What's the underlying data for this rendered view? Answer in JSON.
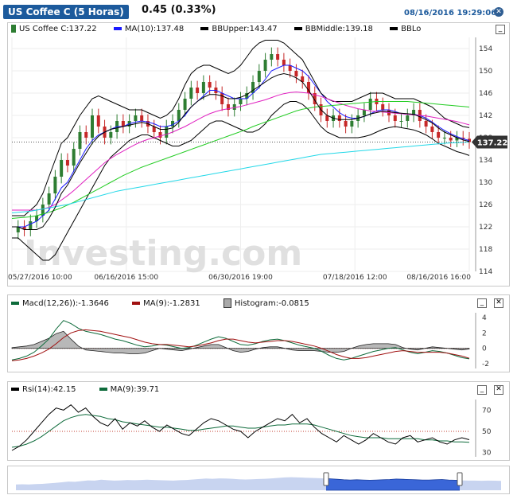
{
  "header": {
    "title": "US Coffee C (5 Horas)",
    "change": "0.45 (0.33%)",
    "datetime": "08/16/2016 19:29:06"
  },
  "main_panel": {
    "legend": [
      {
        "label": "US Coffee C:137.22",
        "color": "#2e7d32"
      },
      {
        "label": "MA(10):137.48",
        "color": "#1a1aff"
      },
      {
        "label": "BBUpper:143.47",
        "color": "#000000"
      },
      {
        "label": "BBMiddle:139.18",
        "color": "#000000"
      },
      {
        "label": "BBLo",
        "color": "#000000"
      }
    ],
    "minimize_label": "_",
    "price_tag": "137.22",
    "watermark": "Investing.com"
  },
  "macd_panel": {
    "legend": [
      {
        "label": "Macd(12,26)):-1.3646",
        "color": "#0e6b3b"
      },
      {
        "label": "MA(9):-1.2831",
        "color": "#a01010"
      },
      {
        "label": "Histogram:-0.0815",
        "color": "#888888"
      }
    ],
    "minimize_label": "_",
    "close_label": "✕"
  },
  "rsi_panel": {
    "legend": [
      {
        "label": "Rsi(14):42.15",
        "color": "#000000"
      },
      {
        "label": "MA(9):39.71",
        "color": "#0e6b3b"
      }
    ],
    "minimize_label": "_",
    "close_label": "✕"
  },
  "colors": {
    "brand": "#1c5a9c",
    "up_candle": "#2e7d32",
    "down_candle": "#c62828",
    "ma10": "#1a1aff",
    "ma_pink": "#e020c0",
    "ma_green": "#22cc22",
    "ma_cyan": "#22d8e8",
    "bands": "#000000",
    "navigator_fill": "#3a66d8"
  },
  "chart_data": [
    {
      "type": "line",
      "x_ticks": [
        "05/27/2016 10:00",
        "06/16/2016 15:00",
        "06/30/2016 19:00",
        "07/18/2016 12:00",
        "08/16/2016 16:00"
      ],
      "y_ticks": [
        114,
        118,
        122,
        126,
        130,
        134,
        138,
        142,
        146,
        150,
        154
      ],
      "ylim": [
        114,
        156
      ],
      "last_price": 137.22,
      "series": [
        {
          "name": "US Coffee C",
          "values": [
            121,
            122,
            121.5,
            123,
            124,
            126,
            128,
            131,
            134,
            133,
            136,
            139,
            138,
            142,
            140,
            138,
            139,
            141,
            140,
            141,
            142,
            141,
            140,
            139,
            138,
            140,
            141,
            143,
            145,
            147,
            146,
            148,
            147,
            146,
            144,
            143,
            144,
            145,
            146,
            148,
            150,
            152,
            153,
            152,
            151,
            150,
            149,
            148,
            146,
            144,
            142,
            141,
            142,
            141,
            140,
            141,
            142,
            143,
            145,
            144,
            143,
            142,
            141,
            141,
            142,
            143,
            141,
            140,
            139,
            138,
            138,
            137.5,
            138,
            137.8,
            137.22
          ]
        },
        {
          "name": "MA(10)",
          "values": [
            122,
            122,
            122,
            122.5,
            123,
            124,
            125,
            127,
            129,
            130,
            132,
            134,
            136,
            137.5,
            138.5,
            139,
            139.5,
            140,
            140,
            140.5,
            140.8,
            141,
            140.8,
            140.5,
            140,
            140,
            140.3,
            141,
            142,
            143.5,
            144.5,
            145.5,
            146.5,
            146.5,
            146,
            145.5,
            145,
            145,
            145,
            146,
            147,
            148.5,
            150,
            150.5,
            151,
            151,
            150.5,
            150,
            149,
            147.5,
            146,
            144.5,
            143.5,
            142.5,
            141.8,
            141.5,
            141.5,
            141.8,
            142.3,
            142.8,
            143,
            143,
            142.7,
            142.3,
            142.2,
            142.2,
            142,
            141.5,
            140.8,
            140,
            139.3,
            138.7,
            138.2,
            137.8,
            137.48
          ]
        },
        {
          "name": "BBUpper",
          "values": [
            124,
            124,
            124,
            125,
            126,
            128,
            131,
            134,
            137,
            138,
            140,
            142,
            143.5,
            145,
            145.5,
            145,
            144.5,
            144,
            143.5,
            143,
            143,
            143,
            142.5,
            142,
            141.5,
            142,
            143,
            145,
            147.5,
            149.5,
            150.5,
            151,
            151,
            150.5,
            150,
            149.5,
            150,
            151,
            152.5,
            154,
            155,
            155.5,
            155.5,
            155.5,
            155,
            154,
            153,
            152,
            150,
            148,
            146,
            145,
            144.5,
            144.5,
            144.5,
            144.5,
            145,
            145.5,
            146,
            146,
            146,
            145.5,
            145,
            145,
            145,
            145,
            144.5,
            144,
            143.5,
            142.5,
            141.5,
            141,
            140.5,
            140,
            139.8
          ]
        },
        {
          "name": "BBLower",
          "values": [
            120,
            120,
            119,
            118,
            117,
            116,
            116,
            117,
            119,
            121,
            123,
            125,
            127,
            129,
            131,
            133,
            134.5,
            135.5,
            136.5,
            137.5,
            138,
            138.5,
            138.5,
            138,
            137.5,
            137,
            136.5,
            136.5,
            137,
            137.5,
            138.5,
            139.5,
            140.5,
            141,
            141,
            140.5,
            140,
            139.5,
            139,
            139,
            139.5,
            140.5,
            142,
            143,
            144,
            144.5,
            144.5,
            144,
            143,
            141.5,
            140,
            139,
            138.5,
            138,
            138,
            138,
            138,
            138.2,
            138.5,
            139,
            139.5,
            139.8,
            140,
            139.8,
            139.6,
            139.4,
            139,
            138.5,
            137.8,
            137,
            136.5,
            136,
            135.5,
            135.2,
            134.8
          ]
        },
        {
          "name": "MA pink",
          "values": [
            125,
            125,
            125,
            125,
            125,
            125.2,
            125.5,
            126,
            126.8,
            127.6,
            128.5,
            129.5,
            130.5,
            131.5,
            132.5,
            133.5,
            134.3,
            135,
            135.6,
            136.2,
            136.8,
            137.3,
            137.7,
            138,
            138.3,
            138.6,
            139,
            139.5,
            140,
            140.6,
            141.2,
            141.8,
            142.3,
            142.7,
            143,
            143.2,
            143.4,
            143.6,
            143.9,
            144.2,
            144.5,
            144.8,
            145.2,
            145.6,
            145.9,
            146.1,
            146.2,
            146.1,
            146,
            145.7,
            145.4,
            145,
            144.6,
            144.2,
            143.8,
            143.5,
            143.2,
            143,
            142.8,
            142.7,
            142.6,
            142.5,
            142.4,
            142.3,
            142.2,
            142.1,
            142,
            141.9,
            141.7,
            141.5,
            141.3,
            141.1,
            140.9,
            140.6,
            140.3
          ]
        },
        {
          "name": "MA green",
          "values": [
            123.5,
            123.6,
            123.7,
            123.8,
            124,
            124.3,
            124.6,
            125,
            125.4,
            125.9,
            126.4,
            127,
            127.6,
            128.2,
            128.8,
            129.4,
            130,
            130.6,
            131.2,
            131.7,
            132.2,
            132.7,
            133.1,
            133.5,
            133.9,
            134.3,
            134.7,
            135.1,
            135.5,
            135.9,
            136.3,
            136.7,
            137.1,
            137.5,
            137.9,
            138.3,
            138.7,
            139.1,
            139.5,
            140,
            140.4,
            140.8,
            141.2,
            141.6,
            142,
            142.4,
            142.8,
            143.1,
            143.3,
            143.5,
            143.6,
            143.7,
            143.8,
            143.9,
            144,
            144.1,
            144.2,
            144.3,
            144.4,
            144.5,
            144.5,
            144.5,
            144.5,
            144.5,
            144.5,
            144.4,
            144.3,
            144.2,
            144.1,
            144,
            143.9,
            143.8,
            143.7,
            143.6,
            143.5
          ]
        },
        {
          "name": "MA cyan",
          "values": [
            124.5,
            124.6,
            124.7,
            124.8,
            125,
            125.2,
            125.4,
            125.6,
            125.8,
            126,
            126.3,
            126.6,
            126.9,
            127.2,
            127.5,
            127.8,
            128.1,
            128.4,
            128.6,
            128.8,
            129,
            129.2,
            129.4,
            129.6,
            129.8,
            130,
            130.2,
            130.4,
            130.6,
            130.8,
            131,
            131.2,
            131.4,
            131.6,
            131.8,
            132,
            132.2,
            132.4,
            132.6,
            132.8,
            133,
            133.2,
            133.4,
            133.6,
            133.8,
            134,
            134.2,
            134.4,
            134.6,
            134.8,
            135,
            135.1,
            135.2,
            135.3,
            135.4,
            135.5,
            135.6,
            135.7,
            135.8,
            135.9,
            136,
            136.1,
            136.2,
            136.3,
            136.4,
            136.5,
            136.6,
            136.7,
            136.8,
            136.9,
            137,
            137.05,
            137.1,
            137.15,
            137.2
          ]
        }
      ]
    },
    {
      "type": "line",
      "y_ticks": [
        4,
        2,
        0,
        -2
      ],
      "ylim": [
        -2.6,
        4.6
      ],
      "series": [
        {
          "name": "Macd(12,26))",
          "values": [
            -1.5,
            -1.3,
            -1.0,
            -0.5,
            0.3,
            1.2,
            2.5,
            3.6,
            3.2,
            2.6,
            2.2,
            2.0,
            1.8,
            1.5,
            1.2,
            1.0,
            0.7,
            0.4,
            0.2,
            0.3,
            0.5,
            0.4,
            0.2,
            0.0,
            0.1,
            0.4,
            0.8,
            1.2,
            1.5,
            1.3,
            0.9,
            0.5,
            0.4,
            0.6,
            0.9,
            1.1,
            1.2,
            1.0,
            0.7,
            0.4,
            0.2,
            0.0,
            -0.4,
            -0.9,
            -1.3,
            -1.5,
            -1.3,
            -1.0,
            -0.7,
            -0.4,
            -0.2,
            0.0,
            0.1,
            -0.2,
            -0.5,
            -0.7,
            -0.5,
            -0.3,
            -0.4,
            -0.6,
            -0.9,
            -1.2,
            -1.36
          ]
        },
        {
          "name": "MA(9)",
          "values": [
            -1.6,
            -1.5,
            -1.3,
            -1.0,
            -0.6,
            -0.1,
            0.6,
            1.4,
            2.0,
            2.3,
            2.4,
            2.3,
            2.2,
            2.0,
            1.8,
            1.6,
            1.4,
            1.1,
            0.8,
            0.6,
            0.5,
            0.5,
            0.4,
            0.3,
            0.2,
            0.3,
            0.5,
            0.7,
            1.0,
            1.2,
            1.2,
            1.0,
            0.8,
            0.7,
            0.8,
            0.9,
            1.0,
            1.0,
            0.9,
            0.7,
            0.5,
            0.3,
            0.0,
            -0.4,
            -0.8,
            -1.1,
            -1.3,
            -1.3,
            -1.2,
            -1.0,
            -0.8,
            -0.6,
            -0.4,
            -0.3,
            -0.4,
            -0.5,
            -0.5,
            -0.5,
            -0.5,
            -0.6,
            -0.8,
            -1.0,
            -1.28
          ]
        },
        {
          "name": "Histogram",
          "values": [
            0.1,
            0.2,
            0.3,
            0.5,
            0.9,
            1.3,
            1.9,
            2.2,
            1.2,
            0.3,
            -0.2,
            -0.3,
            -0.4,
            -0.5,
            -0.6,
            -0.6,
            -0.7,
            -0.7,
            -0.6,
            -0.3,
            0.0,
            -0.1,
            -0.2,
            -0.3,
            -0.1,
            0.1,
            0.3,
            0.5,
            0.5,
            0.1,
            -0.3,
            -0.5,
            -0.4,
            -0.1,
            0.1,
            0.2,
            0.2,
            0.0,
            -0.2,
            -0.3,
            -0.3,
            -0.3,
            -0.4,
            -0.5,
            -0.5,
            -0.4,
            0.0,
            0.3,
            0.5,
            0.6,
            0.6,
            0.6,
            0.5,
            0.1,
            -0.1,
            -0.2,
            0.0,
            0.2,
            0.1,
            0.0,
            -0.1,
            -0.2,
            -0.08
          ]
        }
      ]
    },
    {
      "type": "line",
      "y_ticks": [
        70,
        50,
        30
      ],
      "ylim": [
        26,
        80
      ],
      "reference_line": 50,
      "series": [
        {
          "name": "Rsi(14)",
          "values": [
            32,
            36,
            42,
            50,
            58,
            66,
            72,
            70,
            75,
            68,
            72,
            64,
            58,
            55,
            62,
            52,
            58,
            55,
            60,
            54,
            50,
            56,
            52,
            48,
            46,
            52,
            58,
            62,
            60,
            56,
            52,
            50,
            44,
            50,
            54,
            58,
            62,
            60,
            66,
            58,
            62,
            54,
            48,
            44,
            40,
            46,
            42,
            38,
            42,
            48,
            44,
            40,
            38,
            44,
            46,
            40,
            42,
            44,
            40,
            38,
            42,
            44,
            42.15
          ]
        },
        {
          "name": "MA(9)",
          "values": [
            35,
            36,
            38,
            41,
            45,
            50,
            55,
            60,
            63,
            65,
            66,
            65,
            64,
            62,
            61,
            59,
            58,
            57,
            56,
            55,
            54,
            54,
            53,
            52,
            51,
            51,
            52,
            53,
            54,
            55,
            55,
            54,
            53,
            53,
            54,
            55,
            56,
            56,
            57,
            57,
            57,
            56,
            54,
            52,
            50,
            48,
            46,
            45,
            44,
            44,
            44,
            43,
            43,
            43,
            43,
            43,
            42,
            42,
            41,
            41,
            40,
            40,
            39.71
          ]
        }
      ]
    }
  ]
}
